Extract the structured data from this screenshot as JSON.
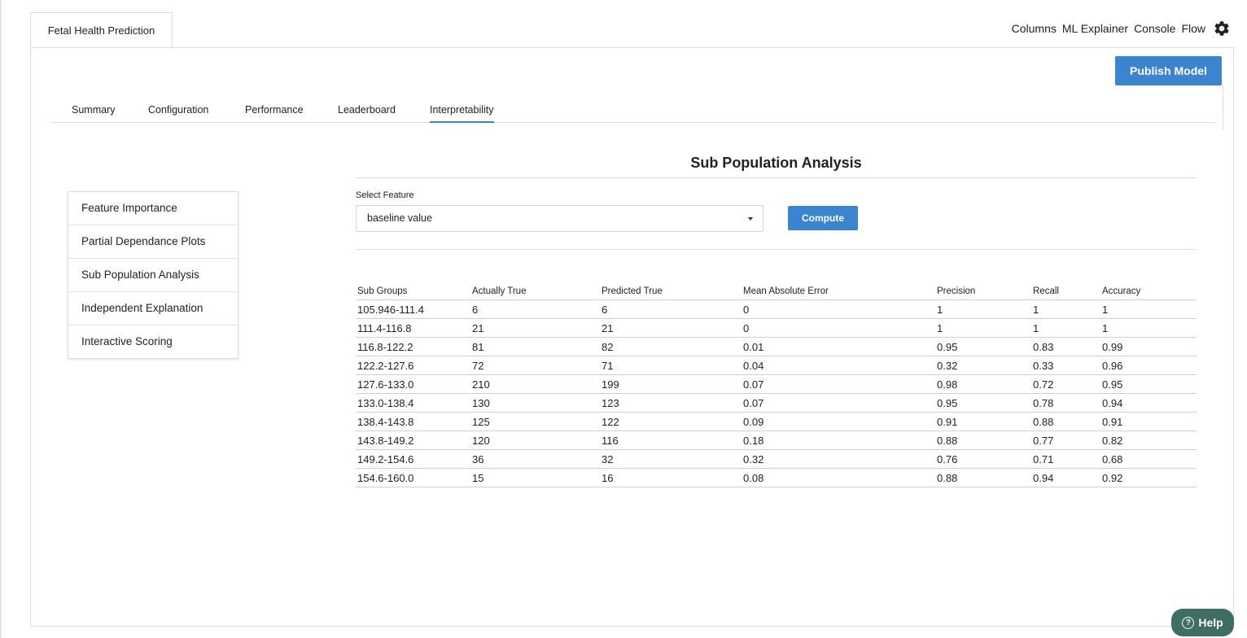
{
  "header": {
    "project_tab": "Fetal Health Prediction",
    "nav": [
      "Columns",
      "ML Explainer",
      "Console",
      "Flow"
    ]
  },
  "actions": {
    "publish_label": "Publish Model"
  },
  "tabs": [
    {
      "label": "Summary"
    },
    {
      "label": "Configuration"
    },
    {
      "label": "Performance"
    },
    {
      "label": "Leaderboard"
    },
    {
      "label": "Interpretability",
      "active": true
    }
  ],
  "side_menu": [
    {
      "label": "Feature Importance"
    },
    {
      "label": "Partial Dependance Plots"
    },
    {
      "label": "Sub Population Analysis"
    },
    {
      "label": "Independent Explanation"
    },
    {
      "label": "Interactive Scoring"
    }
  ],
  "content": {
    "title": "Sub Population Analysis",
    "select_label": "Select Feature",
    "select_value": "baseline value",
    "compute_label": "Compute"
  },
  "table": {
    "columns": [
      "Sub Groups",
      "Actually True",
      "Predicted True",
      "Mean Absolute Error",
      "Precision",
      "Recall",
      "Accuracy"
    ],
    "rows": [
      [
        "105.946-111.4",
        "6",
        "6",
        "0",
        "1",
        "1",
        "1"
      ],
      [
        "111.4-116.8",
        "21",
        "21",
        "0",
        "1",
        "1",
        "1"
      ],
      [
        "116.8-122.2",
        "81",
        "82",
        "0.01",
        "0.95",
        "0.83",
        "0.99"
      ],
      [
        "122.2-127.6",
        "72",
        "71",
        "0.04",
        "0.32",
        "0.33",
        "0.96"
      ],
      [
        "127.6-133.0",
        "210",
        "199",
        "0.07",
        "0.98",
        "0.72",
        "0.95"
      ],
      [
        "133.0-138.4",
        "130",
        "123",
        "0.07",
        "0.95",
        "0.78",
        "0.94"
      ],
      [
        "138.4-143.8",
        "125",
        "122",
        "0.09",
        "0.91",
        "0.88",
        "0.91"
      ],
      [
        "143.8-149.2",
        "120",
        "116",
        "0.18",
        "0.88",
        "0.77",
        "0.82"
      ],
      [
        "149.2-154.6",
        "36",
        "32",
        "0.32",
        "0.76",
        "0.71",
        "0.68"
      ],
      [
        "154.6-160.0",
        "15",
        "16",
        "0.08",
        "0.88",
        "0.94",
        "0.92"
      ]
    ]
  },
  "help": {
    "label": "Help"
  },
  "colors": {
    "accent": "#3a84d0",
    "help": "#3e6d62"
  },
  "icons": {
    "settings": "gear-icon",
    "help": "question-icon",
    "dropdown": "caret-down-icon"
  }
}
